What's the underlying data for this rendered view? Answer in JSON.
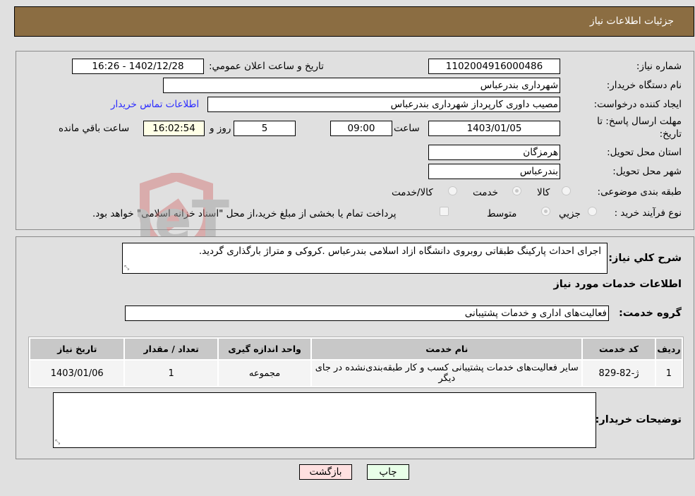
{
  "header": {
    "title": "جزئیات اطلاعات نیاز"
  },
  "details": {
    "need_number_label": "شماره نیاز:",
    "need_number": "1102004916000486",
    "announce_label": "تاریخ و ساعت اعلان عمومي:",
    "announce_value": "1402/12/28 - 16:26",
    "buyer_org_label": "نام دستگاه خریدار:",
    "buyer_org": "شهرداری بندرعباس",
    "creator_label": "ایجاد کننده درخواست:",
    "creator": "مصیب داوری کارپرداز شهرداری بندرعباس",
    "contact_link": "اطلاعات تماس خریدار",
    "deadline_label_line1": "مهلت ارسال پاسخ: تا",
    "deadline_label_line2": "تاریخ:",
    "deadline_date": "1403/01/05",
    "time_label": "ساعت",
    "deadline_time": "09:00",
    "days_value": "5",
    "days_label": "روز و",
    "remaining_time": "16:02:54",
    "remaining_label": "ساعت باقي مانده",
    "province_label": "استان محل تحویل:",
    "province": "هرمزگان",
    "city_label": "شهر محل تحویل:",
    "city": "بندرعباس",
    "category_label": "طبقه بندی موضوعی:",
    "category_options": [
      {
        "label": "کالا",
        "checked": false
      },
      {
        "label": "خدمت",
        "checked": true
      },
      {
        "label": "کالا/خدمت",
        "checked": false
      }
    ],
    "process_label": "نوع فرآیند خرید :",
    "process_options": [
      {
        "label": "جزیي",
        "checked": false
      },
      {
        "label": "متوسط",
        "checked": true
      }
    ],
    "treasury_note": "پرداخت تمام یا بخشی از مبلغ خرید،از محل \"اسناد خزانه اسلامی\" خواهد بود."
  },
  "description": {
    "label": "شرح کلي نیاز:",
    "text": "اجرای احداث پارکینگ طبقاتی روبروی دانشگاه ازاد اسلامی بندرعباس .کروکی و متراژ بارگذاری گردید."
  },
  "services": {
    "section_title": "اطلاعات خدمات مورد نیاز",
    "group_label": "گروه خدمت:",
    "group_value": "فعالیت‌های اداری و خدمات پشتیبانی",
    "columns": [
      "ردیف",
      "کد خدمت",
      "نام خدمت",
      "واحد اندازه گیری",
      "تعداد / مقدار",
      "تاریخ نیاز"
    ],
    "rows": [
      {
        "index": "1",
        "code": "ژ-82-829",
        "name": "سایر فعالیت‌های خدمات پشتیبانی کسب و کار طبقه‌بندی‌نشده در جای دیگر",
        "unit": "مجموعه",
        "quantity": "1",
        "date": "1403/01/06"
      }
    ]
  },
  "buyer_notes": {
    "label": "توضیحات خریدار:",
    "value": ""
  },
  "actions": {
    "print": "چاپ",
    "back": "بازگشت"
  },
  "watermark": {
    "text": "AriaTender.neT"
  }
}
